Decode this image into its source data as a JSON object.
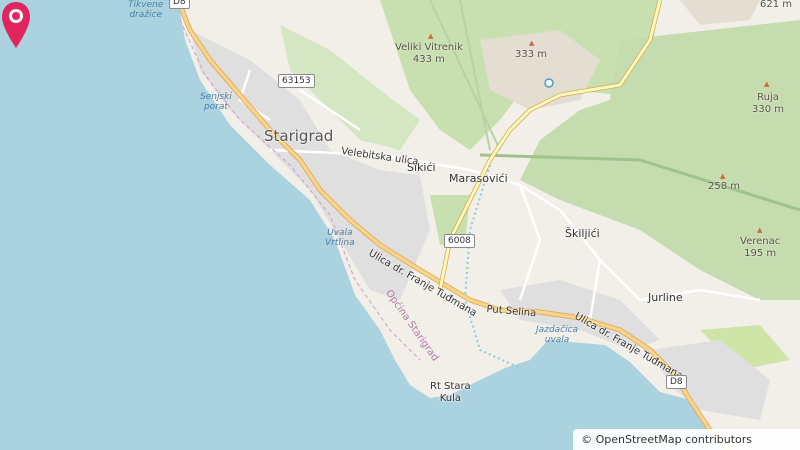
{
  "map": {
    "places": {
      "starigrad": "Starigrad",
      "sikici": "Sikići",
      "marasovici": "Marasovići",
      "skiljici": "Škiljići",
      "jurline": "Jurline",
      "rt_stara_kula": "Rt Stara\nKula"
    },
    "water": {
      "tikvene_drazice": "Tikvene\ndražice",
      "senjski_porat": "Senjski\nporat",
      "uvala_vrtlina": "Uvala\nVrtlina",
      "jazdacica_uvala": "Jazdačica\nuvala"
    },
    "peaks": {
      "veliki_vitrenik": "Veliki Vitrenik\n433 m",
      "p333": "333 m",
      "p621": "621 m",
      "ruja": "Ruja\n330 m",
      "p258": "258 m",
      "verenac": "Verenac\n195 m"
    },
    "streets": {
      "velebitska": "Velebitska ulica",
      "tudmana_1": "Ulica dr. Franje Tuđmana",
      "put_selina": "Put Selina",
      "tudmana_2": "Ulica dr. Franje Tuđmana"
    },
    "admin": {
      "opcina": "Općina Starigrad"
    },
    "shields": {
      "d8_top": "D8",
      "r63153": "63153",
      "r6008": "6008",
      "d8_bottom": "D8"
    },
    "attribution": "© OpenStreetMap contributors",
    "colors": {
      "water": "#aad3df",
      "land": "#f2efe9",
      "forest": "#c8dfb0",
      "road_major": "#f8d38d",
      "marker": "#e0245e"
    }
  }
}
